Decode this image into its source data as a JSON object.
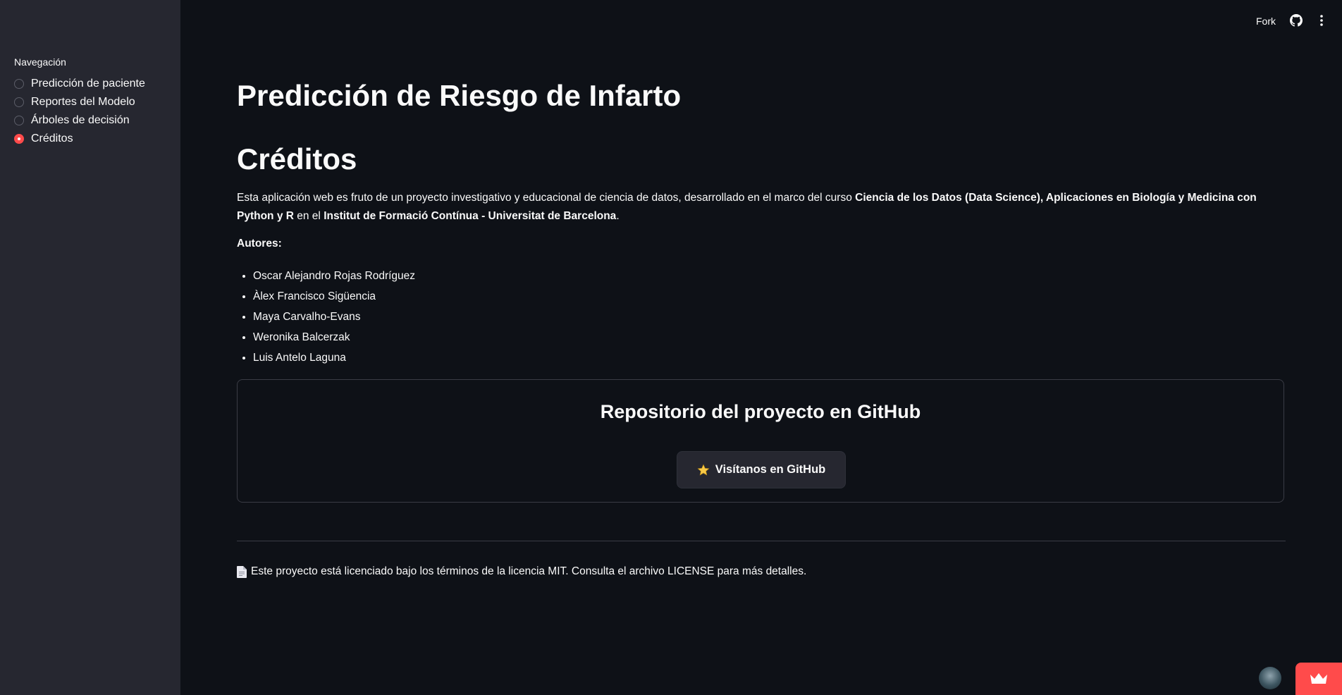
{
  "sidebar": {
    "heading": "Navegación",
    "items": [
      {
        "label": "Predicción de paciente",
        "selected": false
      },
      {
        "label": "Reportes del Modelo",
        "selected": false
      },
      {
        "label": "Árboles de decisión",
        "selected": false
      },
      {
        "label": "Créditos",
        "selected": true
      }
    ]
  },
  "topbar": {
    "fork_label": "Fork",
    "icons": [
      "github-icon",
      "menu-icon"
    ]
  },
  "main": {
    "title": "Predicción de Riesgo de Infarto",
    "section_title": "Créditos",
    "intro": {
      "text_1": "Esta aplicación web es fruto de un proyecto investigativo y educacional de ciencia de datos, desarrollado en el marco del curso ",
      "course": "Ciencia de los Datos (Data Science), Aplicaciones en Biología y Medicina con Python y R",
      "text_2": " en el ",
      "institution": "Institut de Formació Contínua - Universitat de Barcelona",
      "text_3": "."
    },
    "authors_label": "Autores:",
    "authors": [
      "Oscar Alejandro Rojas Rodríguez",
      "Àlex Francisco Sigüencia",
      "Maya Carvalho-Evans",
      "Weronika Balcerzak",
      "Luis Antelo Laguna"
    ],
    "repo": {
      "title": "Repositorio del proyecto en GitHub",
      "button_label": "Visítanos en GitHub",
      "button_icon": "star-icon"
    },
    "license": {
      "icon": "document-icon",
      "text": "Este proyecto está licenciado bajo los términos de la licencia MIT. Consulta el archivo LICENSE para más detalles."
    }
  },
  "colors": {
    "background": "#0e1117",
    "sidebar": "#262730",
    "accent": "#ff4b4b",
    "text": "#fafafa"
  }
}
